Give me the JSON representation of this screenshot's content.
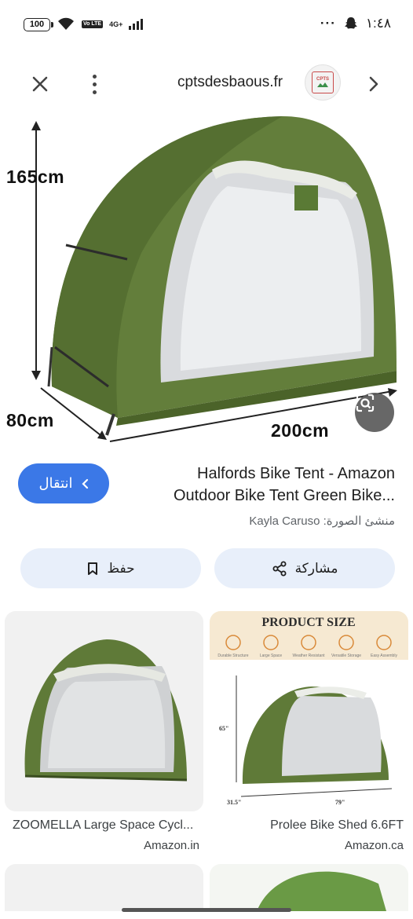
{
  "status_bar": {
    "battery": "100",
    "network_type": "4G+",
    "volte_label": "Vo LTE",
    "time": "١:٤٨",
    "more_dots": "···"
  },
  "top_bar": {
    "domain": "cptsdesbaous.fr",
    "logo_text": "CPTS"
  },
  "hero": {
    "height_label": "165cm",
    "depth_label": "80cm",
    "width_label": "200cm"
  },
  "result": {
    "visit_label": "انتقال",
    "title_line1": "Halfords Bike Tent - Amazon",
    "title_line2": "Outdoor Bike Tent Green Bike...",
    "creator": "منشئ الصورة: Kayla Caruso"
  },
  "actions": {
    "save_label": "حفظ",
    "share_label": "مشاركة"
  },
  "related": [
    {
      "title": "ZOOMELLA Large Space Cycl...",
      "source": "Amazon.in"
    },
    {
      "title": "Prolee Bike Shed 6.6FT",
      "source": "Amazon.ca",
      "image_text": {
        "heading": "PRODUCT SIZE",
        "features": [
          "Durable Structure",
          "Large Space",
          "Weather Resistant",
          "Versatile Storage",
          "Easy Assembly"
        ],
        "height": "65\"",
        "depth": "31.5\"",
        "width": "79\""
      }
    }
  ],
  "colors": {
    "accent": "#3b78e7",
    "action_bg": "#e8effa",
    "tent_green": "#5f7a38"
  }
}
